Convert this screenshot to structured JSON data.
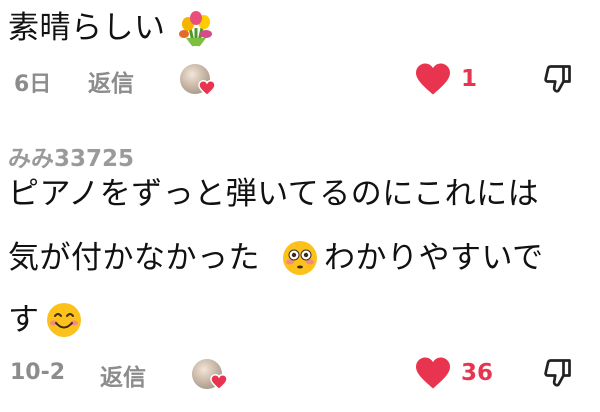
{
  "colors": {
    "like": "#e8344e",
    "meta": "#8c8c8c",
    "text": "#111111"
  },
  "comment1": {
    "text": "素晴らしい",
    "emoji": "bouquet-emoji",
    "time": "6日",
    "reply_label": "返信",
    "like_count": "1"
  },
  "comment2": {
    "username": "みみ33725",
    "line1": "ピアノをずっと弾いてるのにこれには",
    "line2a": "気が付かなかった",
    "line2b": "わかりやすいで",
    "line3": "す",
    "emoji1": "flushed-face-emoji",
    "emoji2": "smiling-face-emoji",
    "time": "10-2",
    "reply_label": "返信",
    "like_count": "36"
  }
}
